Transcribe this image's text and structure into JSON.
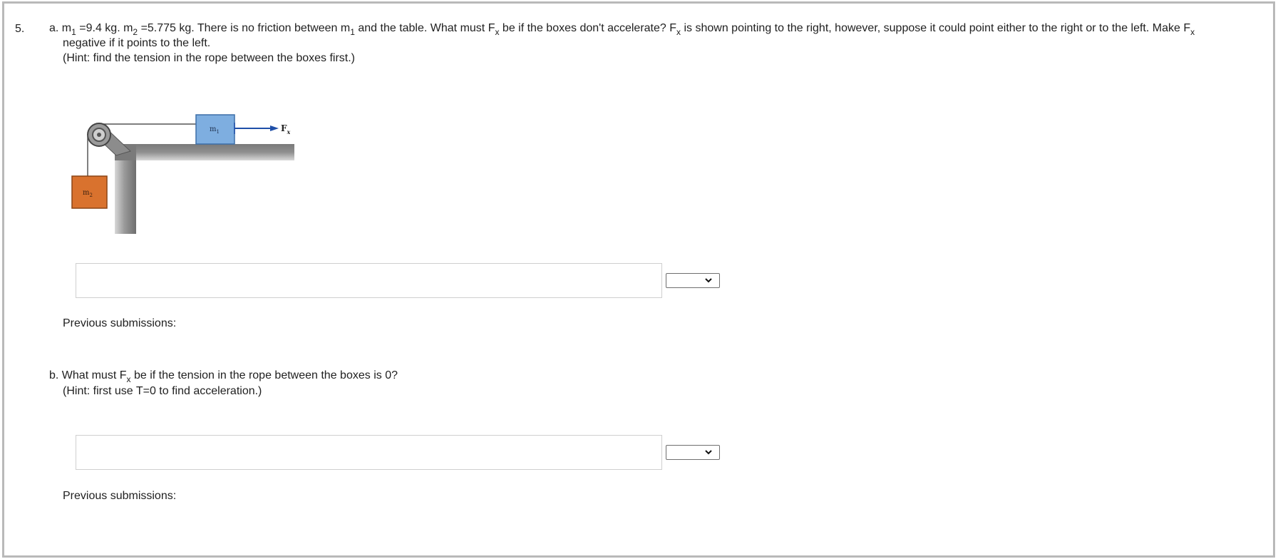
{
  "question": {
    "number": "5.",
    "part_a": {
      "label": "a.",
      "m1_sym": "m",
      "m1_sub": "1",
      "m1_val": "=9.4 kg.",
      "m2_sym": "m",
      "m2_sub": "2",
      "m2_val": "=5.775 kg. There is no friction between",
      "m1b_sym": "m",
      "m1b_sub": "1",
      "text_after_m1": "and the table. What must",
      "fx1_sym": "F",
      "fx1_sub": "x",
      "text_after_fx1": "be if the boxes don't accelerate?",
      "fx2_sym": "F",
      "fx2_sub": "x",
      "text_after_fx2": "is shown pointing to the right, however, suppose it could point either to the right or to the left. Make",
      "fx3_sym": "F",
      "fx3_sub": "x",
      "line2": "negative if it points to the left.",
      "hint": "(Hint: find the tension in the rope between the boxes first.)",
      "answer_value": "",
      "unit_selected": "",
      "previous_submissions": "Previous submissions:"
    },
    "part_b": {
      "label": "b.",
      "text_before": "What must",
      "fx_sym": "F",
      "fx_sub": "x",
      "text_after": "be if the tension in the rope between the boxes is 0?",
      "hint": "(Hint: first use T=0 to find acceleration.)",
      "answer_value": "",
      "unit_selected": "",
      "previous_submissions": "Previous submissions:"
    },
    "figure": {
      "m1_label": "m",
      "m1_sub": "1",
      "m2_label": "m",
      "m2_sub": "2",
      "force_label": "F",
      "force_sub": "x",
      "colors": {
        "m1_box": "#7eaee0",
        "m2_box": "#d9722e",
        "arrow": "#1f4fa8",
        "table": "#8a8a8a"
      }
    }
  }
}
